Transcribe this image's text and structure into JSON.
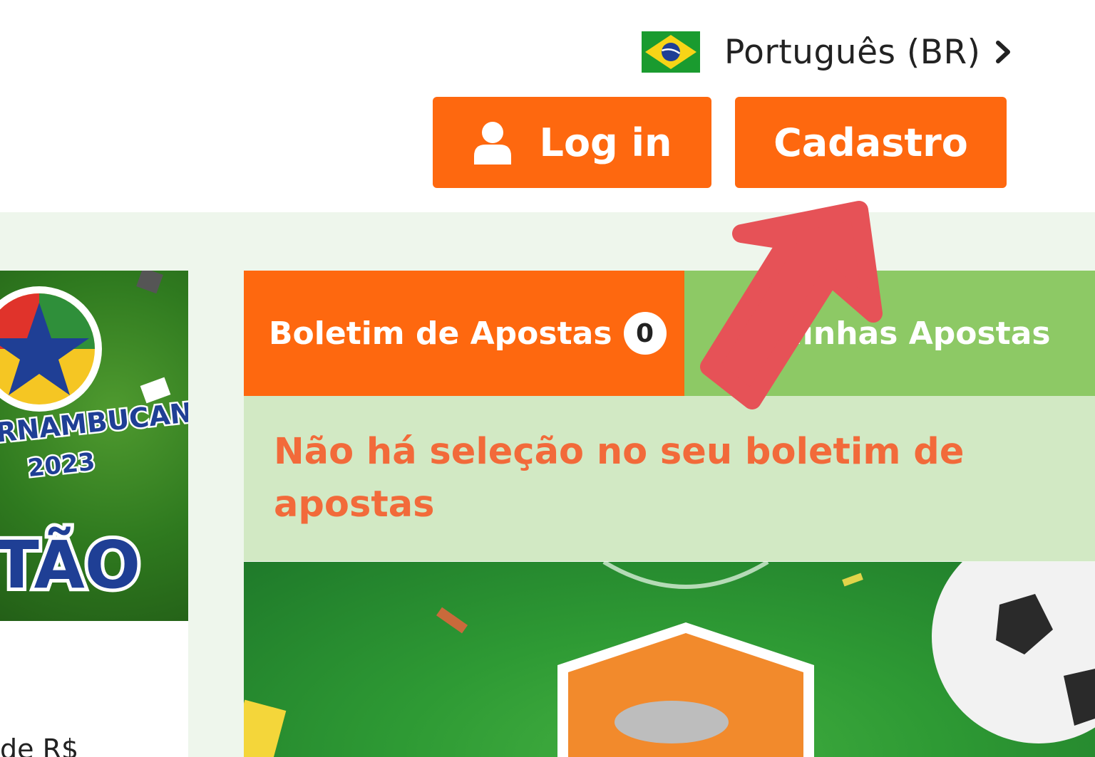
{
  "header": {
    "language": {
      "label": "Português (BR)",
      "flag_icon": "brazil-flag-icon",
      "chevron_icon": "chevron-right-icon"
    },
    "login_button": {
      "label": "Log in",
      "icon": "user-icon"
    },
    "signup_button": {
      "label": "Cadastro"
    }
  },
  "colors": {
    "accent_orange": "#fe680f",
    "tab_green": "#8dc965",
    "panel_green": "#d2e9c4",
    "message_orange": "#f26a3a",
    "annotation_arrow": "#e65257"
  },
  "promo": {
    "image_text_1": "RNAMBUCANO",
    "image_text_2": "2023",
    "image_text_3": "TÃO",
    "caption": "de R$"
  },
  "betslip": {
    "tabs": [
      {
        "label": "Boletim de Apostas",
        "count": "0",
        "active": true
      },
      {
        "label": "Minhas Apostas",
        "active": false
      }
    ],
    "empty_message": "Não há seleção no seu boletim de apostas"
  }
}
